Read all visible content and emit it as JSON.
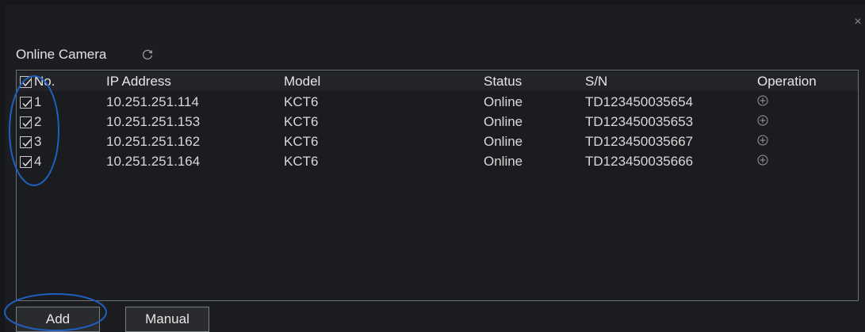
{
  "dialog": {
    "title": "Online Camera",
    "close_icon": "close-icon",
    "refresh_icon": "refresh-icon"
  },
  "table": {
    "columns": [
      "No.",
      "IP Address",
      "Model",
      "Status",
      "S/N",
      "Operation"
    ],
    "header_checked": true,
    "rows": [
      {
        "no": "1",
        "ip": "10.251.251.114",
        "model": "KCT6",
        "status": "Online",
        "sn": "TD123450035654",
        "checked": true
      },
      {
        "no": "2",
        "ip": "10.251.251.153",
        "model": "KCT6",
        "status": "Online",
        "sn": "TD123450035653",
        "checked": true
      },
      {
        "no": "3",
        "ip": "10.251.251.162",
        "model": "KCT6",
        "status": "Online",
        "sn": "TD123450035667",
        "checked": true
      },
      {
        "no": "4",
        "ip": "10.251.251.164",
        "model": "KCT6",
        "status": "Online",
        "sn": "TD123450035666",
        "checked": true
      }
    ],
    "operation_icon": "add-circle-icon"
  },
  "buttons": {
    "add": "Add",
    "manual": "Manual"
  },
  "colors": {
    "background": "#1c1d20",
    "text": "#d8d8d8",
    "annotation": "#1f5fbf"
  }
}
